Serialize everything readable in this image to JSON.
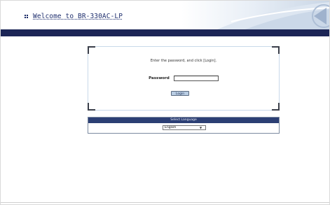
{
  "header": {
    "title": "Welcome to BR-330AC-LP"
  },
  "login": {
    "instruction": "Enter the password, and click [Login].",
    "password_label": "Password",
    "password_value": "",
    "login_button_label": "Login"
  },
  "language": {
    "heading": "Select Language",
    "selected": "English",
    "options": [
      "English"
    ]
  },
  "colors": {
    "nav_bar": "#1c2556",
    "language_header": "#2c3f74",
    "login_button": "#b9cde3",
    "title_text": "#1f2f6e"
  }
}
